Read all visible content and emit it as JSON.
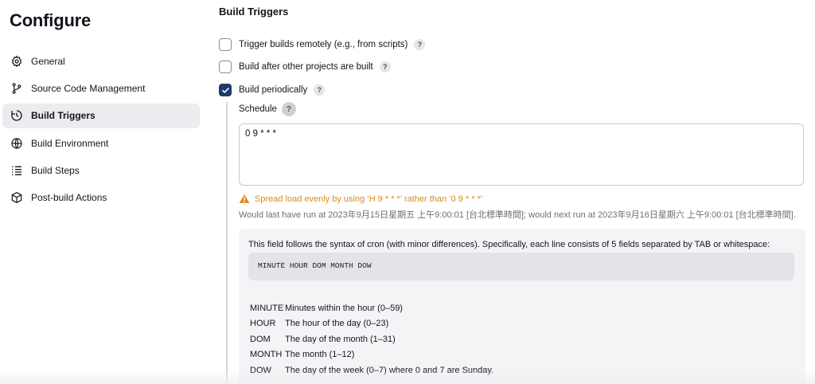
{
  "page": {
    "title": "Configure"
  },
  "sidebar": {
    "items": [
      {
        "label": "General",
        "icon": "gear-icon"
      },
      {
        "label": "Source Code Management",
        "icon": "branch-icon"
      },
      {
        "label": "Build Triggers",
        "icon": "clock-refresh-icon",
        "active": true
      },
      {
        "label": "Build Environment",
        "icon": "globe-icon"
      },
      {
        "label": "Build Steps",
        "icon": "list-icon"
      },
      {
        "label": "Post-build Actions",
        "icon": "cube-icon"
      }
    ]
  },
  "triggers": {
    "section_title": "Build Triggers",
    "options": [
      {
        "label": "Trigger builds remotely (e.g., from scripts)",
        "checked": false
      },
      {
        "label": "Build after other projects are built",
        "checked": false
      },
      {
        "label": "Build periodically",
        "checked": true
      }
    ],
    "help_glyph": "?"
  },
  "schedule": {
    "label": "Schedule",
    "value": "0 9 * * *",
    "warning": "Spread load evenly by using ‘H 9 * * *’ rather than ‘0 9 * * *’",
    "run_info": "Would last have run at 2023年9月15日星期五 上午9:00:01 [台北標準時間]; would next run at 2023年9月16日星期六 上午9:00:01 [台北標準時間]."
  },
  "help": {
    "intro": "This field follows the syntax of cron (with minor differences). Specifically, each line consists of 5 fields separated by TAB or whitespace:",
    "code": "MINUTE HOUR DOM MONTH DOW",
    "fields": [
      {
        "name": "MINUTE",
        "desc": "Minutes within the hour (0–59)"
      },
      {
        "name": "HOUR",
        "desc": "The hour of the day (0–23)"
      },
      {
        "name": "DOM",
        "desc": "The day of the month (1–31)"
      },
      {
        "name": "MONTH",
        "desc": "The month (1–12)"
      },
      {
        "name": "DOW",
        "desc": "The day of the week (0–7) where 0 and 7 are Sunday."
      }
    ]
  },
  "colors": {
    "accent": "#1f3b6d",
    "warning": "#de8a1d",
    "active_nav_bg": "#ececf0"
  }
}
